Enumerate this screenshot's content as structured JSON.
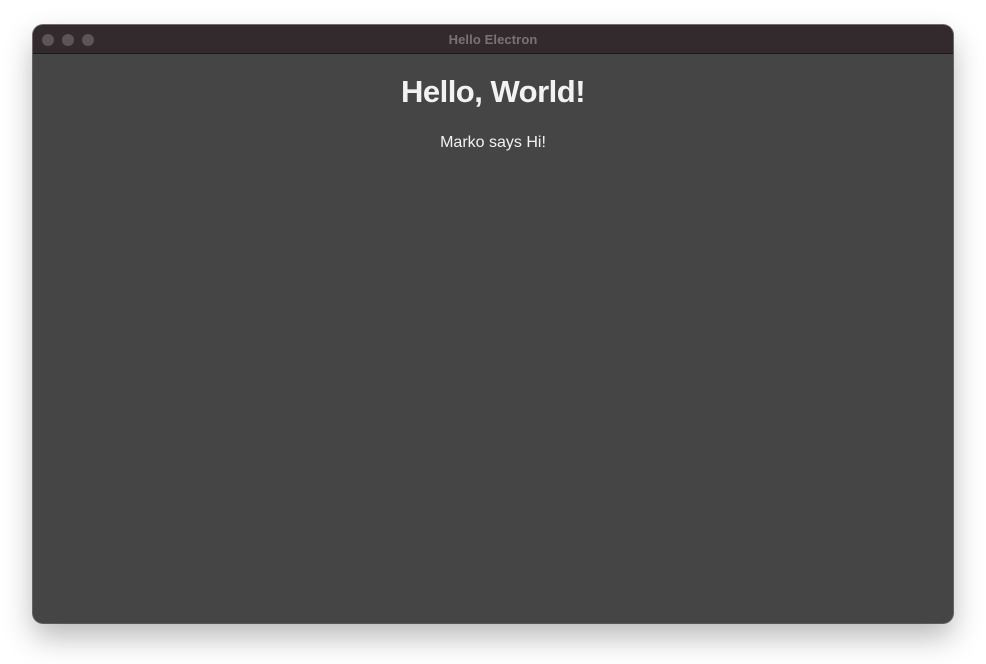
{
  "window": {
    "title": "Hello Electron",
    "colors": {
      "titlebar": "#322a2c",
      "background": "#454545",
      "text": "#f2f2f2",
      "traffic_light": "#5c5557"
    }
  },
  "content": {
    "heading": "Hello, World!",
    "message": "Marko says Hi!"
  }
}
